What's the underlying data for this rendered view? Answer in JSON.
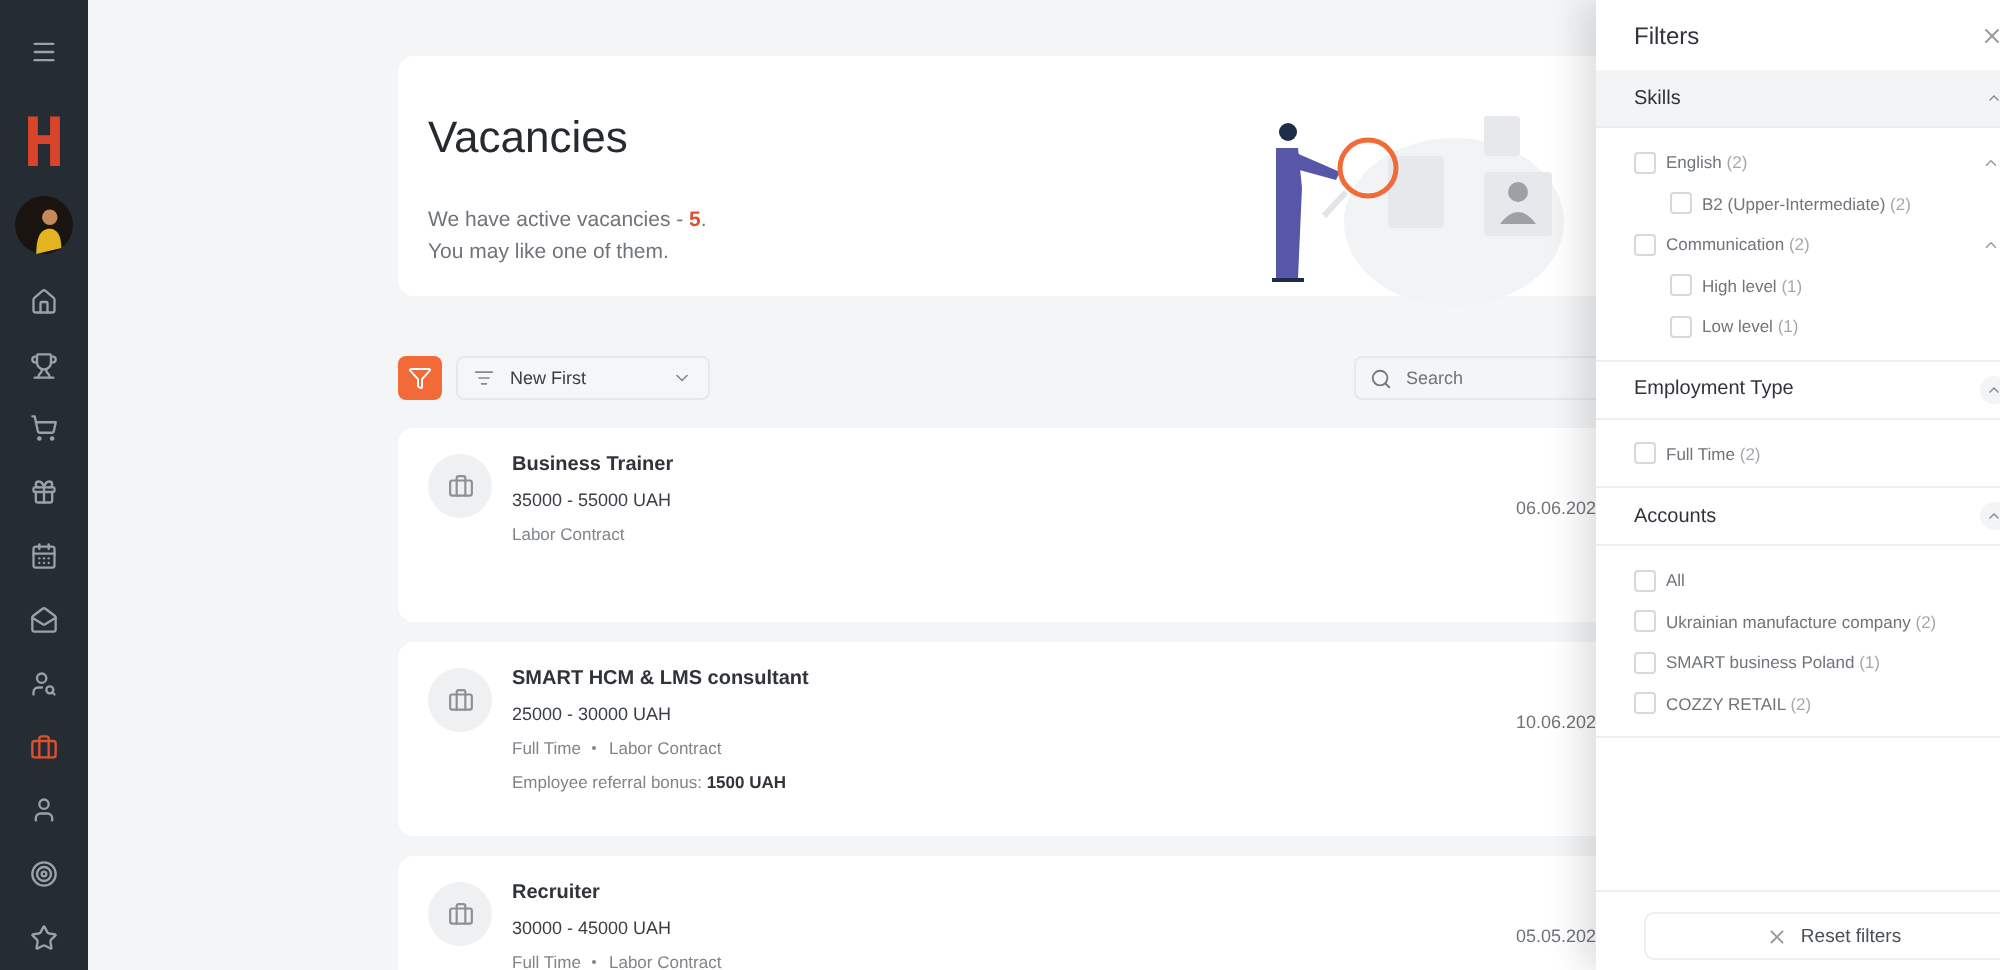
{
  "sidebar": {
    "logo": "H",
    "items": [
      {
        "kind": "home",
        "selected": false
      },
      {
        "kind": "trophy",
        "selected": false
      },
      {
        "kind": "cart",
        "selected": false
      },
      {
        "kind": "gift",
        "selected": false
      },
      {
        "kind": "calendar",
        "selected": false
      },
      {
        "kind": "mail",
        "selected": false
      },
      {
        "kind": "user-search",
        "selected": false
      },
      {
        "kind": "briefcase",
        "selected": true
      },
      {
        "kind": "user",
        "selected": false
      },
      {
        "kind": "target",
        "selected": false
      },
      {
        "kind": "star",
        "selected": false
      }
    ]
  },
  "header": {
    "title": "Vacancies",
    "text": "We have active vacancies - ",
    "count": "5",
    "text_end": ".",
    "subtitle": "You may like one of them."
  },
  "toolbar": {
    "sort": "New First",
    "search": {
      "placeholder": "Search"
    }
  },
  "vacancies": [
    {
      "title": "Business Trainer",
      "salary": "35000 - 55000 UAH",
      "tags": [
        "Labor Contract"
      ],
      "date": "06.06.202"
    },
    {
      "title": "SMART HCM & LMS consultant",
      "salary": "25000 - 30000 UAH",
      "tags": [
        "Full Time",
        "Labor Contract"
      ],
      "bonus_label": "Employee referral bonus: ",
      "bonus": "1500 UAH",
      "date": "10.06.202"
    },
    {
      "title": "Recruiter",
      "salary": "30000 - 45000 UAH",
      "tags": [
        "Full Time",
        "Labor Contract"
      ],
      "date": "05.05.202"
    }
  ],
  "filters": {
    "title": "Filters",
    "sections": [
      {
        "title": "Skills",
        "expanded": true,
        "highlighted": true,
        "items": [
          {
            "label": "English",
            "count": "(2)",
            "checked": false,
            "expanded": true,
            "children": [
              {
                "label": "B2 (Upper-Intermediate)",
                "count": "(2)",
                "checked": false
              }
            ]
          },
          {
            "label": "Communication",
            "count": "(2)",
            "checked": false,
            "expanded": true,
            "children": [
              {
                "label": "High level",
                "count": "(1)",
                "checked": false
              },
              {
                "label": "Low level",
                "count": "(1)",
                "checked": false
              }
            ]
          }
        ]
      },
      {
        "title": "Employment Type",
        "expanded": true,
        "highlighted": false,
        "items": [
          {
            "label": "Full Time",
            "count": "(2)",
            "checked": false
          }
        ]
      },
      {
        "title": "Accounts",
        "expanded": true,
        "highlighted": false,
        "items": [
          {
            "label": "All",
            "checked": false
          },
          {
            "label": "Ukrainian manufacture company",
            "count": "(2)",
            "checked": false
          },
          {
            "label": "SMART business Poland",
            "count": "(1)",
            "checked": false
          },
          {
            "label": "COZZY RETAIL",
            "count": "(2)",
            "checked": false
          }
        ]
      }
    ],
    "reset": "Reset filters"
  }
}
